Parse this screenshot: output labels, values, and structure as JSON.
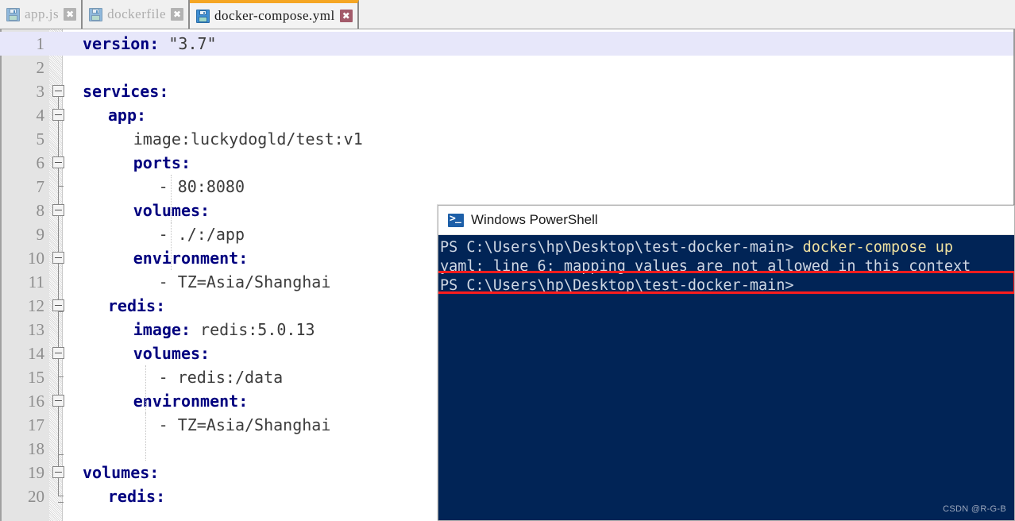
{
  "tabs": [
    {
      "label": "app.js",
      "icon": "floppy-disk-icon",
      "close_icon": "✖",
      "active": false
    },
    {
      "label": "dockerfile",
      "icon": "floppy-disk-icon",
      "close_icon": "✖",
      "active": false
    },
    {
      "label": "docker-compose.yml",
      "icon": "floppy-disk-icon",
      "close_icon": "✖",
      "active": true
    }
  ],
  "editor": {
    "active_line": 1,
    "lines": [
      {
        "n": "1",
        "indent": 0,
        "key": "version:",
        "rest": " \"3.7\"",
        "bold_key": true
      },
      {
        "n": "2",
        "indent": 0,
        "key": "",
        "rest": "",
        "bold_key": false
      },
      {
        "n": "3",
        "indent": 0,
        "key": "services:",
        "rest": "",
        "bold_key": true
      },
      {
        "n": "4",
        "indent": 1,
        "key": "app:",
        "rest": "",
        "bold_key": true
      },
      {
        "n": "5",
        "indent": 2,
        "key": "",
        "rest": "image:luckydogld/test:v1",
        "bold_key": false
      },
      {
        "n": "6",
        "indent": 2,
        "key": "ports:",
        "rest": "",
        "bold_key": true
      },
      {
        "n": "7",
        "indent": 3,
        "key": "",
        "rest": "- 80:8080",
        "bold_key": false
      },
      {
        "n": "8",
        "indent": 2,
        "key": "volumes:",
        "rest": "",
        "bold_key": true
      },
      {
        "n": "9",
        "indent": 3,
        "key": "",
        "rest": "- ./:/app",
        "bold_key": false
      },
      {
        "n": "10",
        "indent": 2,
        "key": "environment:",
        "rest": "",
        "bold_key": true
      },
      {
        "n": "11",
        "indent": 3,
        "key": "",
        "rest": "- TZ=Asia/Shanghai",
        "bold_key": false
      },
      {
        "n": "12",
        "indent": 1,
        "key": "redis:",
        "rest": "",
        "bold_key": true
      },
      {
        "n": "13",
        "indent": 2,
        "key": "image:",
        "rest": " redis:5.0.13",
        "bold_key": true
      },
      {
        "n": "14",
        "indent": 2,
        "key": "volumes:",
        "rest": "",
        "bold_key": true
      },
      {
        "n": "15",
        "indent": 3,
        "key": "",
        "rest": "- redis:/data",
        "bold_key": false
      },
      {
        "n": "16",
        "indent": 2,
        "key": "environment:",
        "rest": "",
        "bold_key": true
      },
      {
        "n": "17",
        "indent": 3,
        "key": "",
        "rest": "- TZ=Asia/Shanghai",
        "bold_key": false
      },
      {
        "n": "18",
        "indent": 0,
        "key": "",
        "rest": "",
        "bold_key": false
      },
      {
        "n": "19",
        "indent": 0,
        "key": "volumes:",
        "rest": "",
        "bold_key": true
      },
      {
        "n": "20",
        "indent": 1,
        "key": "redis:",
        "rest": "",
        "bold_key": true
      }
    ]
  },
  "powershell": {
    "title": "Windows PowerShell",
    "icon": "powershell-prompt-icon",
    "lines": [
      {
        "prompt": "PS C:\\Users\\hp\\Desktop\\test-docker-main> ",
        "cmd": "docker-compose up",
        "highlight": false
      },
      {
        "prompt": "yaml: line 6: mapping values are not allowed in this context",
        "cmd": "",
        "highlight": true
      },
      {
        "prompt": "PS C:\\Users\\hp\\Desktop\\test-docker-main>",
        "cmd": "",
        "highlight": false
      }
    ],
    "watermark": "CSDN @R-G-B",
    "highlight_color": "#fc1d1d",
    "background": "#012456"
  }
}
